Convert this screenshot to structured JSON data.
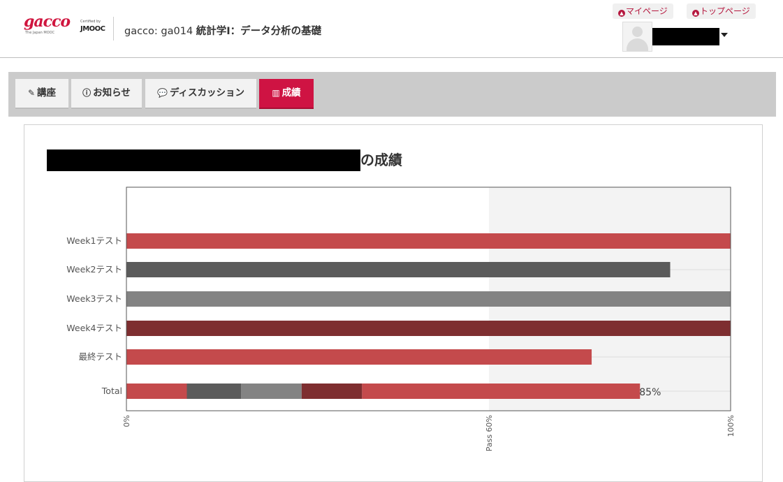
{
  "header": {
    "logo_text": "gacco",
    "logo_sub": "The Japan MOOC",
    "jmooc_certified": "Certified by",
    "jmooc_text": "JMOOC",
    "course_prefix": "gacco: ga014",
    "course_name": "統計学Ⅰ：データ分析の基礎",
    "my_page": "マイページ",
    "top_page": "トップページ"
  },
  "tabs": [
    {
      "label": "講座",
      "icon": "edit-icon",
      "active": false
    },
    {
      "label": "お知らせ",
      "icon": "info-icon",
      "active": false
    },
    {
      "label": "ディスカッション",
      "icon": "comments-icon",
      "active": false
    },
    {
      "label": "成績",
      "icon": "bar-chart-icon",
      "active": true
    }
  ],
  "page": {
    "title_suffix": "の成績"
  },
  "colors": {
    "brand": "#cf1343",
    "red": "#c44a4c",
    "dark_gray": "#5b5b5b",
    "gray": "#838383",
    "dark_red": "#7e2e30"
  },
  "chart_data": {
    "type": "bar",
    "orientation": "horizontal",
    "categories": [
      "Week1テスト",
      "Week2テスト",
      "Week3テスト",
      "Week4テスト",
      "最終テスト"
    ],
    "values": [
      100,
      90,
      100,
      100,
      77
    ],
    "bar_colors": [
      "#c44a4c",
      "#5b5b5b",
      "#838383",
      "#7e2e30",
      "#c44a4c"
    ],
    "total": {
      "label": "Total",
      "segments": [
        {
          "value": 10,
          "color": "#c44a4c"
        },
        {
          "value": 9,
          "color": "#5b5b5b"
        },
        {
          "value": 10,
          "color": "#838383"
        },
        {
          "value": 10,
          "color": "#7e2e30"
        },
        {
          "value": 46,
          "color": "#c44a4c"
        }
      ],
      "value_label": "85%"
    },
    "xlim": [
      0,
      100
    ],
    "x_ticks": [
      {
        "value": 0,
        "label": "0%"
      },
      {
        "value": 60,
        "label": "Pass 60%"
      },
      {
        "value": 100,
        "label": "100%"
      }
    ],
    "pass_threshold": 60
  }
}
